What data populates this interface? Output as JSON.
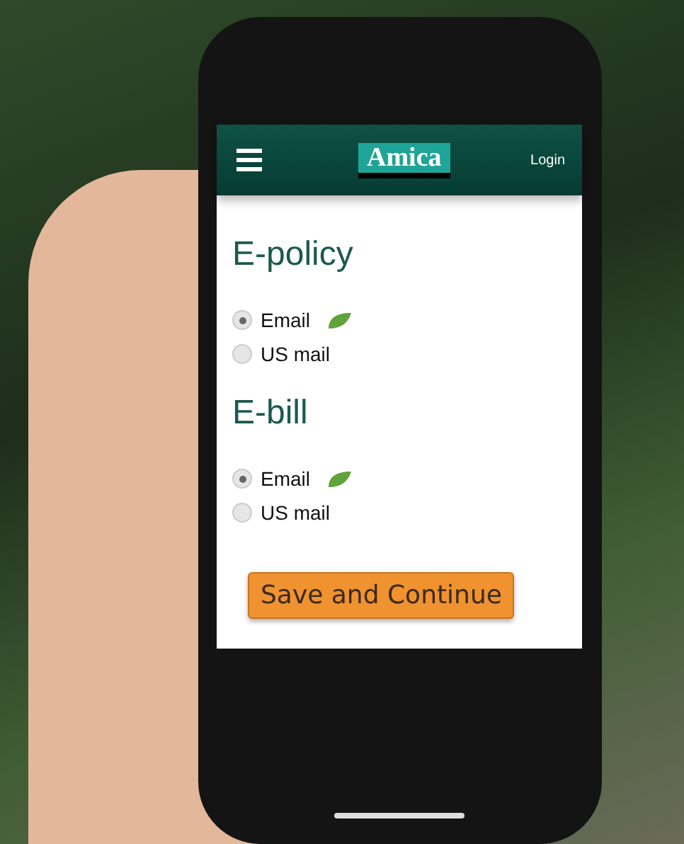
{
  "header": {
    "logo": "Amica",
    "login": "Login"
  },
  "sections": [
    {
      "title": "E-policy",
      "options": [
        {
          "label": "Email",
          "selected": true,
          "leaf": true
        },
        {
          "label": "US mail",
          "selected": false,
          "leaf": false
        }
      ]
    },
    {
      "title": "E-bill",
      "options": [
        {
          "label": "Email",
          "selected": true,
          "leaf": true
        },
        {
          "label": "US mail",
          "selected": false,
          "leaf": false
        }
      ]
    }
  ],
  "button": "Save and Continue"
}
